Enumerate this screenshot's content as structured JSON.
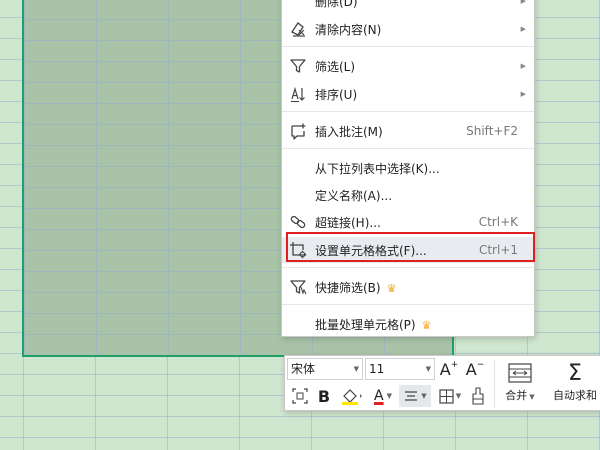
{
  "context_menu": {
    "items": [
      {
        "label": "删除(D)",
        "shortcut": "",
        "submenu": true
      },
      {
        "label": "清除内容(N)",
        "shortcut": "",
        "submenu": true
      },
      {
        "label": "筛选(L)",
        "shortcut": "",
        "submenu": true
      },
      {
        "label": "排序(U)",
        "shortcut": "",
        "submenu": true
      },
      {
        "label": "插入批注(M)",
        "shortcut": "Shift+F2",
        "submenu": false
      },
      {
        "label": "从下拉列表中选择(K)...",
        "shortcut": "",
        "submenu": false
      },
      {
        "label": "定义名称(A)...",
        "shortcut": "",
        "submenu": false
      },
      {
        "label": "超链接(H)...",
        "shortcut": "Ctrl+K",
        "submenu": false
      },
      {
        "label": "设置单元格格式(F)...",
        "shortcut": "Ctrl+1",
        "submenu": false,
        "highlighted": true
      },
      {
        "label": "快捷筛选(B)",
        "shortcut": "",
        "submenu": false,
        "premium": true
      },
      {
        "label": "批量处理单元格(P)",
        "shortcut": "",
        "submenu": false,
        "premium": true
      }
    ]
  },
  "mini_toolbar": {
    "font_name": "宋体",
    "font_size": "11",
    "increase_font_label": "A",
    "decrease_font_label": "A",
    "bold_label": "B",
    "font_color_label": "A",
    "merge_label": "合并",
    "autosum_label": "自动求和"
  },
  "colors": {
    "sheet_background": "#cfe6cf",
    "selection_fill": "#a9c3a8",
    "selection_border": "#1fa06b",
    "highlight_box": "#e02020",
    "premium_crown": "#f5a623",
    "fill_color_swatch": "#ffe600",
    "font_color_swatch": "#e02020"
  }
}
